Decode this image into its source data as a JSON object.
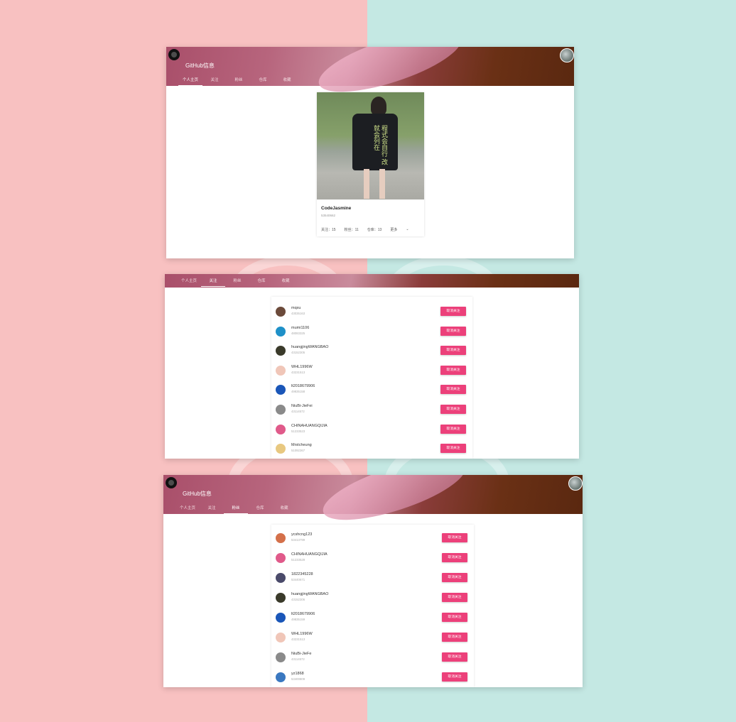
{
  "header": {
    "title": "GitHub信息",
    "tabs": [
      "个人主页",
      "关注",
      "粉丝",
      "仓库",
      "收藏"
    ]
  },
  "profile": {
    "shirt_text": "程式会自行 改就会列在",
    "name": "CodeJasmine",
    "id": "53540662",
    "stats": {
      "following": "关注：15",
      "followers": "粉丝：11",
      "repos": "仓库：13",
      "more": "更多"
    }
  },
  "following": {
    "button_label": "取消关注",
    "users": [
      {
        "name": "mqxu",
        "id": "43035163",
        "color": "#6b4a3a"
      },
      {
        "name": "mumi1106",
        "id": "48083325",
        "color": "#1e90c8"
      },
      {
        "name": "huangjingWANGBAO",
        "id": "43152305",
        "color": "#3a3a2a"
      },
      {
        "name": "WHL1996W",
        "id": "43231513",
        "color": "#f0c6b8"
      },
      {
        "name": "lt2018679906",
        "id": "49835158",
        "color": "#1a56b8"
      },
      {
        "name": "NiuBi-JieFei",
        "id": "43114572",
        "color": "#8a8a8a"
      },
      {
        "name": "CHINAHUANGQIJIA",
        "id": "51233523",
        "color": "#e05a8a"
      },
      {
        "name": "Mrstcheung",
        "id": "51092367",
        "color": "#e8c880"
      }
    ]
  },
  "followers": {
    "button_label": "取消关注",
    "users": [
      {
        "name": "ycshcng123",
        "id": "53413799",
        "color": "#d4704a"
      },
      {
        "name": "CHINAHUANGQIJIA",
        "id": "51233528",
        "color": "#e05a8a"
      },
      {
        "name": "1822345228",
        "id": "53440671",
        "color": "#4a4a6a"
      },
      {
        "name": "huangjingWANGBAO",
        "id": "43152306",
        "color": "#3a3a2a"
      },
      {
        "name": "lt2018679906",
        "id": "49835159",
        "color": "#1a56b8"
      },
      {
        "name": "WHL1996W",
        "id": "43231513",
        "color": "#f0c6b8"
      },
      {
        "name": "NiuBi-JieFe",
        "id": "43114572",
        "color": "#8a8a8a"
      },
      {
        "name": "yz1868",
        "id": "53400809",
        "color": "#3a78c0"
      }
    ]
  }
}
